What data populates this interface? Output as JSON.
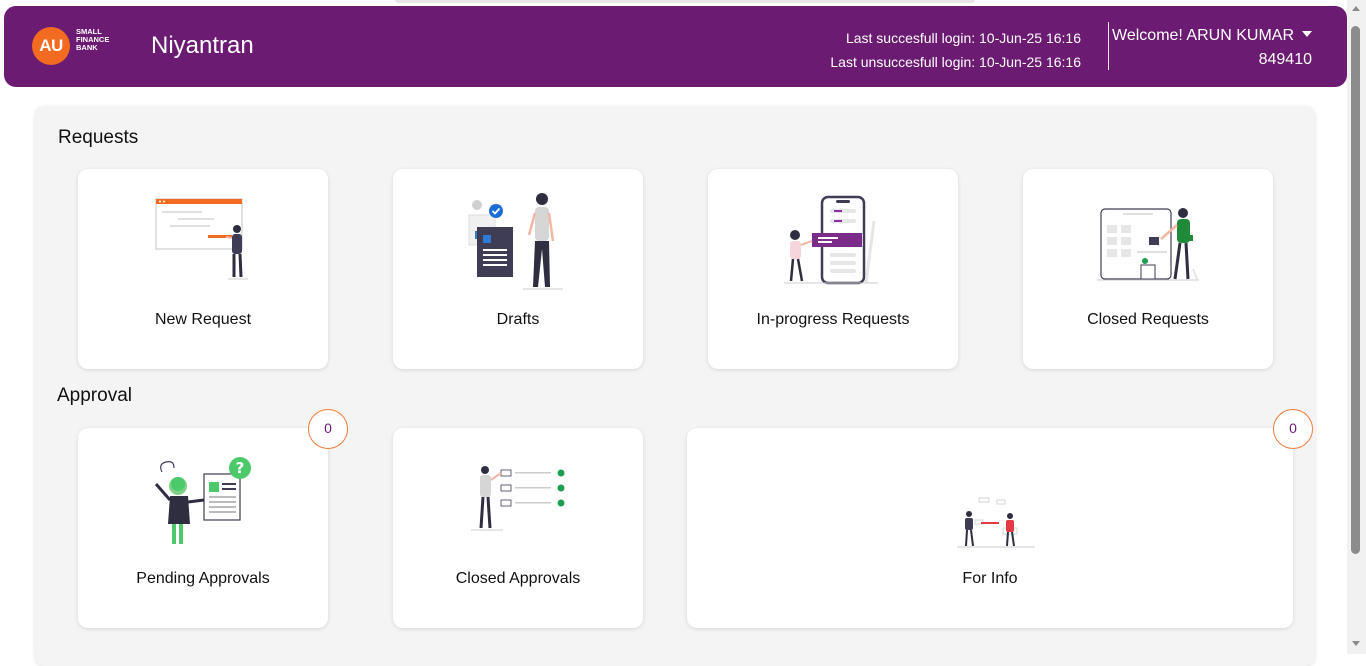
{
  "header": {
    "logo_mark": "AU",
    "logo_lines": [
      "SMALL",
      "FINANCE",
      "BANK"
    ],
    "app_title": "Niyantran",
    "last_success": "Last succesfull login: 10-Jun-25 16:16",
    "last_unsuccess": "Last unsuccesfull login: 10-Jun-25 16:16",
    "welcome": "Welcome! ARUN KUMAR",
    "user_id": "849410"
  },
  "colors": {
    "brand": "#6b1b72",
    "accent": "#f26b21",
    "badge_border": "#f07a3a"
  },
  "requests": {
    "title": "Requests",
    "cards": [
      {
        "label": "New Request",
        "icon": "presentation-illustration"
      },
      {
        "label": "Drafts",
        "icon": "document-draft-illustration"
      },
      {
        "label": "In-progress Requests",
        "icon": "mobile-progress-illustration"
      },
      {
        "label": "Closed Requests",
        "icon": "dashboard-closed-illustration"
      }
    ]
  },
  "approval": {
    "title": "Approval",
    "cards": [
      {
        "label": "Pending Approvals",
        "icon": "question-document-illustration",
        "badge": "0"
      },
      {
        "label": "Closed Approvals",
        "icon": "checklist-illustration"
      },
      {
        "label": "For Info",
        "icon": "collaboration-illustration",
        "badge": "0"
      }
    ]
  }
}
